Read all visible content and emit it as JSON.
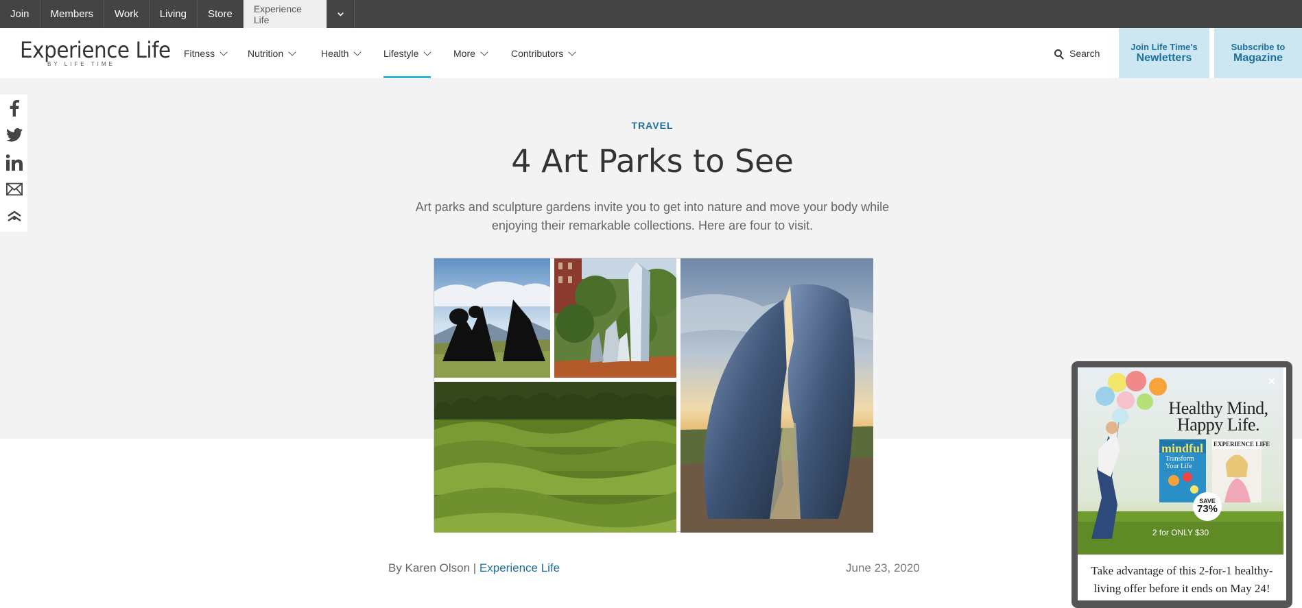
{
  "topbar": {
    "items": [
      "Join",
      "Members",
      "Work",
      "Living",
      "Store"
    ],
    "active": "Experience Life"
  },
  "header": {
    "logo_main": "Experience Life",
    "logo_sub": "BY LIFE TIME",
    "nav": [
      "Fitness",
      "Nutrition",
      "Health",
      "Lifestyle",
      "More",
      "Contributors"
    ],
    "active_nav": "Lifestyle",
    "search_label": "Search",
    "cta_newsletter_small": "Join Life Time's",
    "cta_newsletter_big": "Newletters",
    "cta_magazine_small": "Subscribe to",
    "cta_magazine_big": "Magazine"
  },
  "share": [
    "facebook-icon",
    "twitter-icon",
    "linkedin-icon",
    "email-icon",
    "more-share-icon"
  ],
  "article": {
    "kicker": "TRAVEL",
    "title": "4 Art Parks to See",
    "dek": "Art parks and sculpture gardens invite you to get into nature and move your body while enjoying their remarkable collections. Here are four to visit.",
    "byline_prefix": "By Karen Olson | ",
    "byline_source": "Experience Life",
    "date": "June 23, 2020"
  },
  "ad": {
    "headline_line1": "Healthy Mind,",
    "headline_line2": "Happy Life.",
    "save_label": "SAVE",
    "save_value": "73%",
    "offer": "2 for ONLY $30",
    "text": "Take advantage of this 2-for-1 healthy-living offer before it ends on May 24!",
    "close": "×",
    "mag1_title": "mindful",
    "mag1_sub": "Transform Your Life",
    "mag2_title": "EXPERIENCE LIFE"
  },
  "colors": {
    "topbar": "#444444",
    "accent": "#1d6f9c",
    "nav_underline": "#2bb5d7",
    "hero_bg": "#f3f3f3",
    "cta_bg": "#cde7f2"
  }
}
